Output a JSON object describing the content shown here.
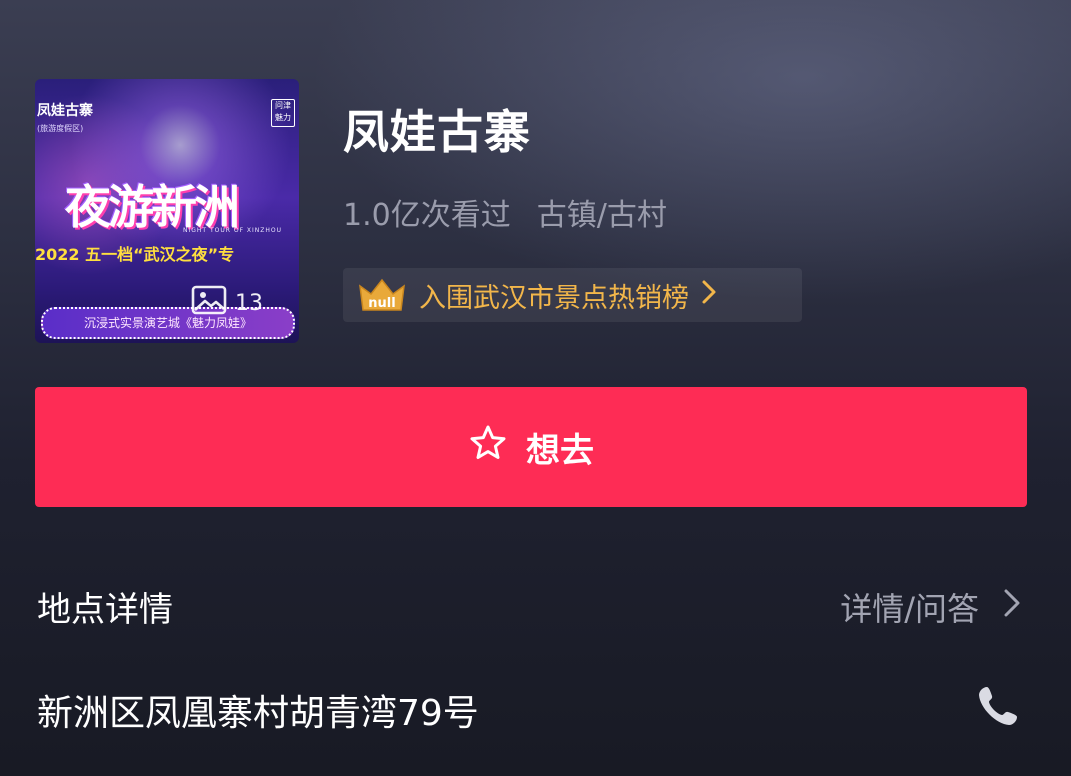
{
  "cover": {
    "brand": "凤娃古寨",
    "brand_sub": "(旅游度假区)",
    "tag": "问津魅力",
    "headline": "夜游新洲",
    "subtitle_en": "NIGHT TOUR OF XINZHOU",
    "ribbon": "2022 五一档“武汉之夜”专",
    "pill": "沉浸式实景演艺城《魅力凤娃》",
    "photo_count": "13",
    "icon": "image-gallery-icon"
  },
  "place": {
    "name": "凤娃古寨",
    "views": "1.0亿次看过",
    "category": "古镇/古村"
  },
  "rank": {
    "badge_text": "null",
    "text": "入围武汉市景点热销榜",
    "icon": "chevron-right-icon",
    "color": "#f2b64a"
  },
  "want_button": {
    "label": "想去",
    "icon": "star-outline-icon",
    "color": "#fe2c55"
  },
  "details": {
    "title": "地点详情",
    "link_label": "详情/问答",
    "address": "新洲区凤凰寨村胡青湾79号",
    "phone_icon": "phone-icon"
  }
}
